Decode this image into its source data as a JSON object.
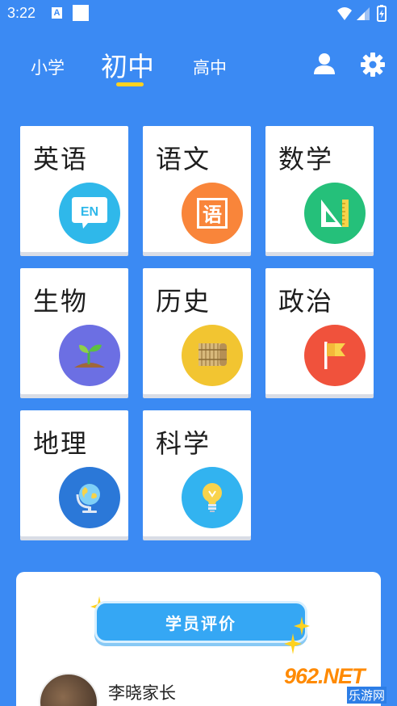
{
  "status_bar": {
    "time": "3:22",
    "a_icon_letter": "A"
  },
  "nav": {
    "tabs": [
      {
        "label": "小学"
      },
      {
        "label": "初中"
      },
      {
        "label": "高中"
      }
    ],
    "selected_tab": "初中",
    "accent_color": "#ffd21f",
    "user_icon": "user-icon",
    "settings_icon": "gear-icon"
  },
  "subjects": [
    {
      "label": "英语",
      "icon": "en-speech-bubble-icon",
      "icon_text": "EN",
      "color": "#2fb8ea"
    },
    {
      "label": "语文",
      "icon": "chinese-character-icon",
      "icon_text": "语",
      "color": "#f9853a"
    },
    {
      "label": "数学",
      "icon": "set-square-ruler-icon",
      "color": "#25c07a"
    },
    {
      "label": "生物",
      "icon": "sprout-icon",
      "color": "#6c6fe3"
    },
    {
      "label": "历史",
      "icon": "bamboo-scroll-icon",
      "color": "#f2c531"
    },
    {
      "label": "政治",
      "icon": "flag-icon",
      "color": "#f0523c"
    },
    {
      "label": "地理",
      "icon": "globe-icon",
      "color": "#2b78d8"
    },
    {
      "label": "科学",
      "icon": "lightbulb-icon",
      "color": "#32b3f0"
    }
  ],
  "review": {
    "button_label": "学员评价",
    "reviewer_name": "李晓家长"
  },
  "watermark": {
    "main": "962.NET",
    "sub": "乐游网"
  },
  "colors": {
    "background": "#3b8af3",
    "card": "#ffffff"
  }
}
